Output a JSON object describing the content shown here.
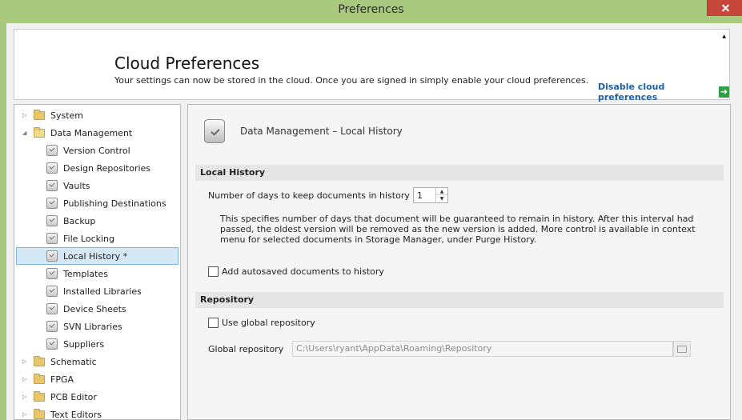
{
  "window": {
    "title": "Preferences"
  },
  "cloud": {
    "heading": "Cloud Preferences",
    "description": "Your settings can now be stored in the cloud. Once you are signed in simply enable your cloud preferences.",
    "disable_link": "Disable cloud preferences"
  },
  "tree": {
    "items": [
      {
        "label": "System",
        "level": 0,
        "type": "folder",
        "expanded": false
      },
      {
        "label": "Data Management",
        "level": 0,
        "type": "folder",
        "expanded": true
      },
      {
        "label": "Version Control",
        "level": 1,
        "type": "page"
      },
      {
        "label": "Design Repositories",
        "level": 1,
        "type": "page"
      },
      {
        "label": "Vaults",
        "level": 1,
        "type": "page"
      },
      {
        "label": "Publishing Destinations",
        "level": 1,
        "type": "page"
      },
      {
        "label": "Backup",
        "level": 1,
        "type": "page"
      },
      {
        "label": "File Locking",
        "level": 1,
        "type": "page"
      },
      {
        "label": "Local History *",
        "level": 1,
        "type": "page",
        "selected": true
      },
      {
        "label": "Templates",
        "level": 1,
        "type": "page"
      },
      {
        "label": "Installed Libraries",
        "level": 1,
        "type": "page"
      },
      {
        "label": "Device Sheets",
        "level": 1,
        "type": "page"
      },
      {
        "label": "SVN Libraries",
        "level": 1,
        "type": "page"
      },
      {
        "label": "Suppliers",
        "level": 1,
        "type": "page"
      },
      {
        "label": "Schematic",
        "level": 0,
        "type": "folder",
        "expanded": false
      },
      {
        "label": "FPGA",
        "level": 0,
        "type": "folder",
        "expanded": false
      },
      {
        "label": "PCB Editor",
        "level": 0,
        "type": "folder",
        "expanded": false
      },
      {
        "label": "Text Editors",
        "level": 0,
        "type": "folder",
        "expanded": false
      }
    ]
  },
  "panel": {
    "title": "Data Management – Local History",
    "local_history": {
      "section_title": "Local History",
      "days_label": "Number of days to keep documents in history",
      "days_value": "1",
      "help_text": "This specifies number of days that document will be guaranteed to remain in history. After this interval had passed, the oldest version will be removed as the new version is added. More control is available in context menu for selected documents in Storage Manager, under Purge History.",
      "autosave_label": "Add autosaved documents to history",
      "autosave_checked": false
    },
    "repository": {
      "section_title": "Repository",
      "use_global_label": "Use global repository",
      "use_global_checked": false,
      "global_repo_label": "Global repository",
      "global_repo_path": "C:\\Users\\ryant\\AppData\\Roaming\\Repository"
    }
  }
}
